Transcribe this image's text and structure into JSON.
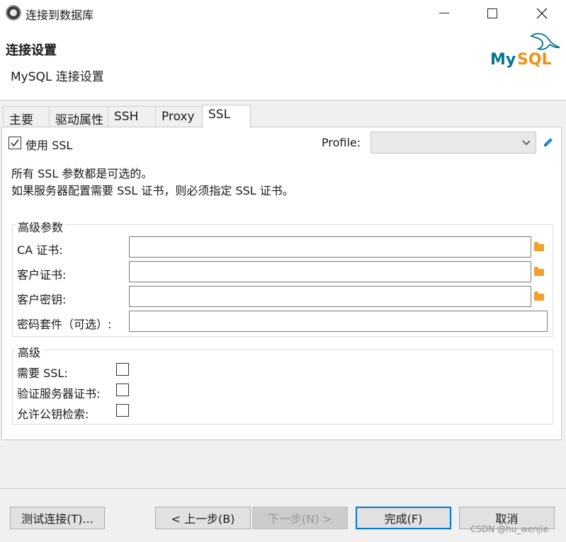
{
  "window": {
    "title": "连接到数据库",
    "min_label": "",
    "max_label": "",
    "close_label": ""
  },
  "header": {
    "title": "连接设置",
    "subtitle": "MySQL 连接设置",
    "logo_text": "MySQL"
  },
  "tabs": [
    {
      "label": "主要",
      "active": false
    },
    {
      "label": "驱动属性",
      "active": false
    },
    {
      "label": "SSH",
      "active": false
    },
    {
      "label": "Proxy",
      "active": false
    },
    {
      "label": "SSL",
      "active": true
    }
  ],
  "ssl": {
    "use_ssl_label": "使用 SSL",
    "use_ssl_checked": true,
    "profile_label": "Profile:",
    "profile_value": "",
    "info_line1": "所有 SSL 参数都是可选的。",
    "info_line2": "如果服务器配置需要 SSL 证书，则必须指定 SSL 证书。"
  },
  "advanced_params": {
    "title": "高级参数",
    "fields": [
      {
        "label": "CA 证书:",
        "value": ""
      },
      {
        "label": "客户证书:",
        "value": ""
      },
      {
        "label": "客户密钥:",
        "value": ""
      },
      {
        "label": "密码套件（可选）:",
        "value": ""
      }
    ]
  },
  "advanced": {
    "title": "高级",
    "options": [
      {
        "label": "需要 SSL:",
        "checked": false
      },
      {
        "label": "验证服务器证书:",
        "checked": false
      },
      {
        "label": "允许公钥检索:",
        "checked": false
      }
    ]
  },
  "buttons": {
    "test": "测试连接(T)...",
    "back": "< 上一步(B)",
    "next": "下一步(N) >",
    "finish": "完成(F)",
    "cancel": "取消"
  },
  "watermark": "CSDN @hu_wenjie",
  "colors": {
    "accent": "#0078d7",
    "folder": "#f0a030",
    "mysql_blue": "#00758f",
    "mysql_orange": "#f29111"
  }
}
